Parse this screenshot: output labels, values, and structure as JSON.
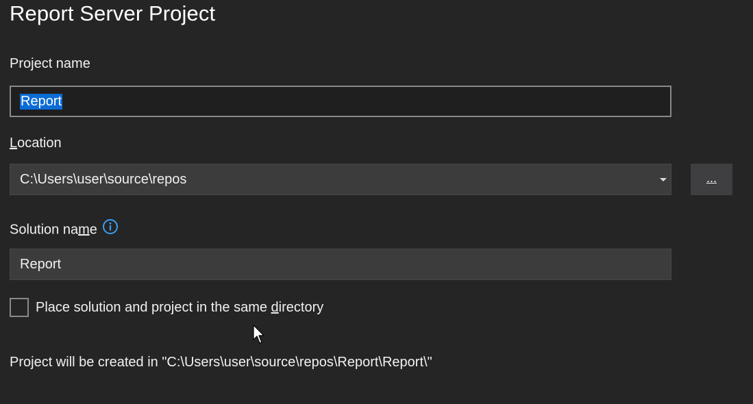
{
  "dialog": {
    "title": "Report Server Project"
  },
  "project_name": {
    "label": "Project name",
    "value": "Report"
  },
  "location": {
    "label_mnemonic": "L",
    "label_rest": "ocation",
    "value": "C:\\Users\\user\\source\\repos",
    "browse_label": "..."
  },
  "solution_name": {
    "label_pre": "Solution na",
    "label_mnemonic": "m",
    "label_post": "e",
    "value": "Report",
    "info_icon": "info-icon"
  },
  "same_directory": {
    "label_pre": "Place solution and project in the same ",
    "label_mnemonic": "d",
    "label_post": "irectory",
    "checked": false
  },
  "footer": {
    "text": "Project will be created in \"C:\\Users\\user\\source\\repos\\Report\\Report\\\""
  },
  "colors": {
    "background": "#252526",
    "selection": "#0b6cd6",
    "info_accent": "#3aa0f3"
  }
}
